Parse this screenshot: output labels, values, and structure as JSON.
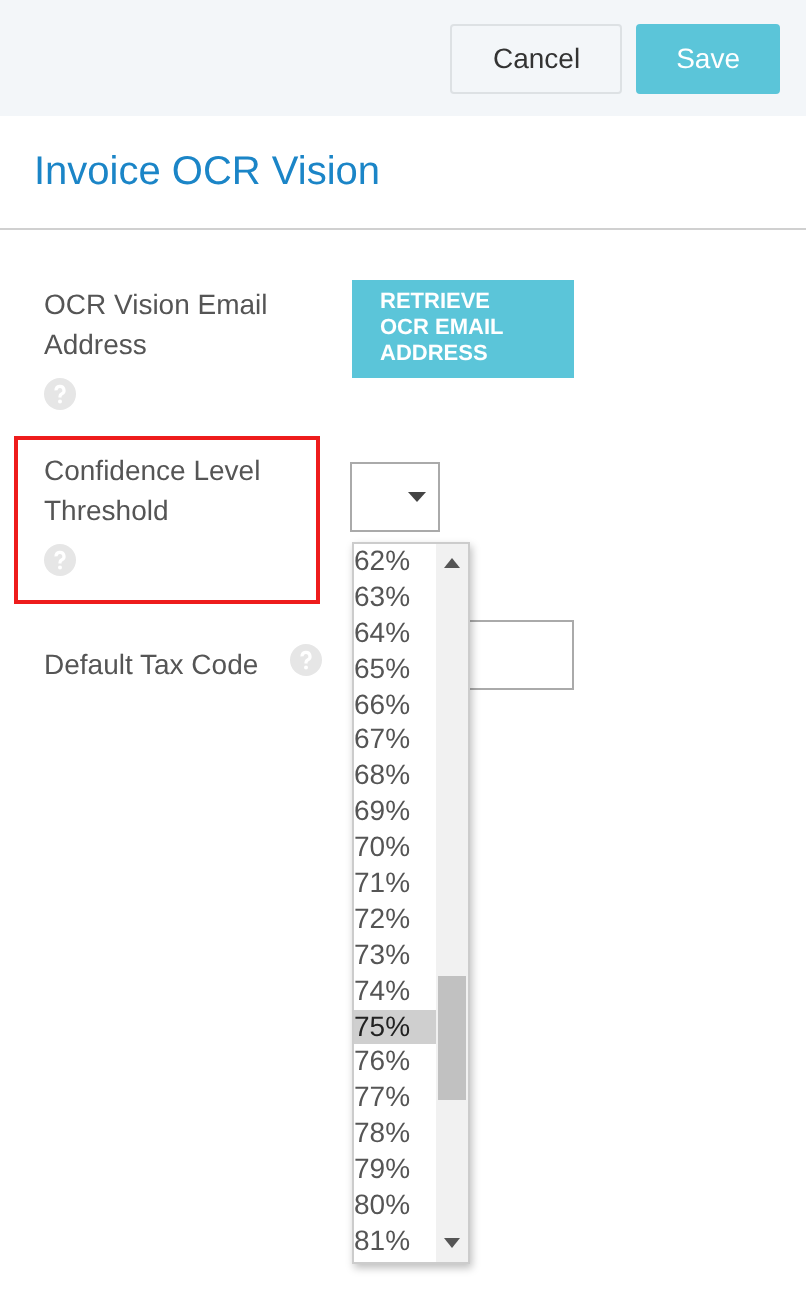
{
  "header": {
    "buttons": [
      {
        "label": "Cancel",
        "kind": "secondary"
      },
      {
        "label": "Save",
        "kind": "primary"
      }
    ]
  },
  "title": "Invoice OCR Vision",
  "fields": [
    {
      "label": "OCR Vision Email Address",
      "kind": "button",
      "button": "RETRIEVE OCR EMAIL ADDRESS",
      "highlighted": false
    },
    {
      "label": "Confidence Level Threshold",
      "kind": "select",
      "highlighted": true,
      "open": true,
      "options": [
        {
          "label": "62%",
          "selected": false
        },
        {
          "label": "63%",
          "selected": false
        },
        {
          "label": "64%",
          "selected": false
        },
        {
          "label": "65%",
          "selected": false
        },
        {
          "label": "66%",
          "selected": false
        },
        {
          "label": "67%",
          "selected": false
        },
        {
          "label": "68%",
          "selected": false
        },
        {
          "label": "69%",
          "selected": false
        },
        {
          "label": "70%",
          "selected": false
        },
        {
          "label": "71%",
          "selected": false
        },
        {
          "label": "72%",
          "selected": false
        },
        {
          "label": "73%",
          "selected": false
        },
        {
          "label": "74%",
          "selected": false
        },
        {
          "label": "75%",
          "selected": true
        },
        {
          "label": "76%",
          "selected": false
        },
        {
          "label": "77%",
          "selected": false
        },
        {
          "label": "78%",
          "selected": false
        },
        {
          "label": "79%",
          "selected": false
        },
        {
          "label": "80%",
          "selected": false
        },
        {
          "label": "81%",
          "selected": false
        }
      ]
    },
    {
      "label": "Default Tax Code",
      "kind": "input",
      "highlighted": false
    }
  ]
}
